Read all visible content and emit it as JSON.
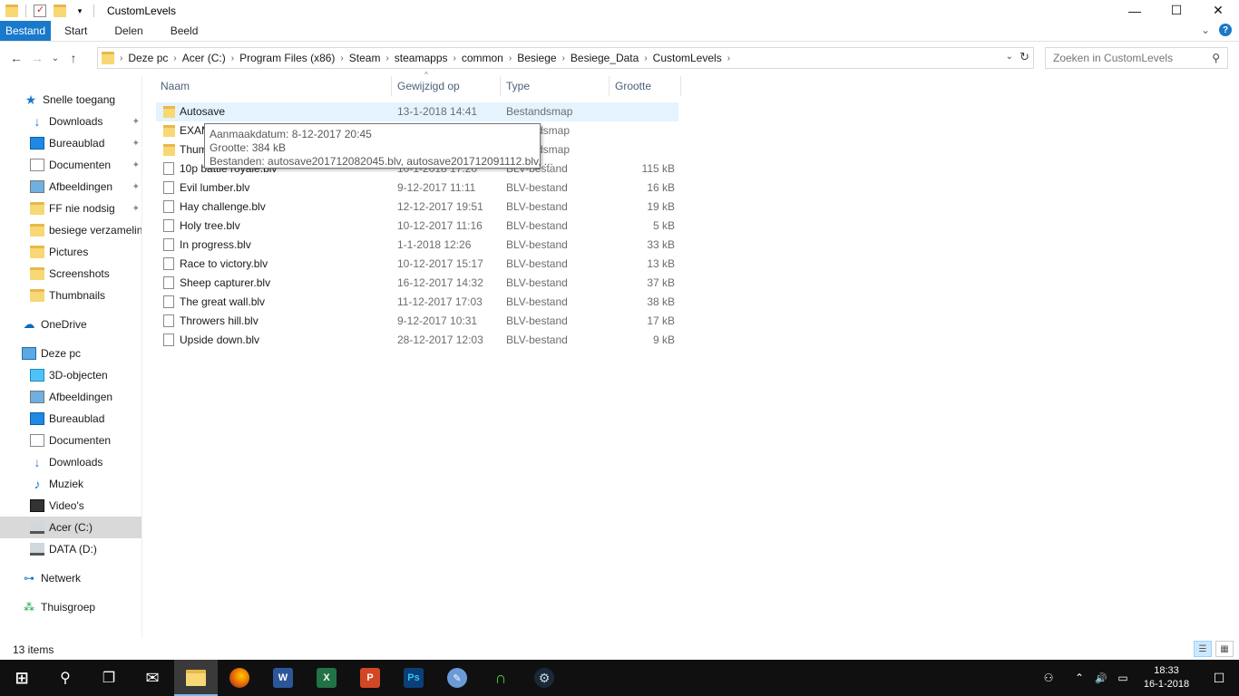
{
  "window": {
    "title": "CustomLevels",
    "minimize": "—",
    "maximize": "☐",
    "close": "✕"
  },
  "ribbon": {
    "tabs": [
      "Bestand",
      "Start",
      "Delen",
      "Beeld"
    ],
    "expand": "⌄",
    "help": "?"
  },
  "nav": {
    "back": "←",
    "forward": "→",
    "recent": "⌄",
    "up": "↑",
    "breadcrumbs": [
      "Deze pc",
      "Acer (C:)",
      "Program Files (x86)",
      "Steam",
      "steamapps",
      "common",
      "Besiege",
      "Besiege_Data",
      "CustomLevels"
    ],
    "dropdown": "⌄",
    "refresh": "↻"
  },
  "search": {
    "placeholder": "Zoeken in CustomLevels",
    "icon": "search-icon"
  },
  "sidebar": {
    "items": [
      {
        "label": "Snelle toegang",
        "icon": "star-icon",
        "pinned": false
      },
      {
        "label": "Downloads",
        "icon": "download-icon",
        "pinned": true
      },
      {
        "label": "Bureaublad",
        "icon": "desktop-icon",
        "pinned": true
      },
      {
        "label": "Documenten",
        "icon": "document-icon",
        "pinned": true
      },
      {
        "label": "Afbeeldingen",
        "icon": "pictures-icon",
        "pinned": true
      },
      {
        "label": "FF nie nodsig",
        "icon": "folder-icon",
        "pinned": true
      },
      {
        "label": "besiege verzameling",
        "icon": "folder-icon",
        "pinned": false
      },
      {
        "label": "Pictures",
        "icon": "folder-icon",
        "pinned": false
      },
      {
        "label": "Screenshots",
        "icon": "folder-icon",
        "pinned": false
      },
      {
        "label": "Thumbnails",
        "icon": "folder-icon",
        "pinned": false
      },
      {
        "label": "OneDrive",
        "icon": "cloud-icon",
        "pinned": false
      },
      {
        "label": "Deze pc",
        "icon": "computer-icon",
        "pinned": false
      },
      {
        "label": "3D-objecten",
        "icon": "3d-objects-icon",
        "pinned": false
      },
      {
        "label": "Afbeeldingen",
        "icon": "pictures-icon",
        "pinned": false
      },
      {
        "label": "Bureaublad",
        "icon": "desktop-icon",
        "pinned": false
      },
      {
        "label": "Documenten",
        "icon": "document-icon",
        "pinned": false
      },
      {
        "label": "Downloads",
        "icon": "download-icon",
        "pinned": false
      },
      {
        "label": "Muziek",
        "icon": "music-icon",
        "pinned": false
      },
      {
        "label": "Video's",
        "icon": "video-icon",
        "pinned": false
      },
      {
        "label": "Acer (C:)",
        "icon": "drive-icon",
        "pinned": false,
        "selected": true
      },
      {
        "label": "DATA (D:)",
        "icon": "drive-icon",
        "pinned": false
      },
      {
        "label": "Netwerk",
        "icon": "network-icon",
        "pinned": false
      },
      {
        "label": "Thuisgroep",
        "icon": "homegroup-icon",
        "pinned": false
      }
    ],
    "pin_glyph": "📌"
  },
  "filelist": {
    "columns": [
      "Naam",
      "Gewijzigd op",
      "Type",
      "Grootte"
    ],
    "sort_glyph": "^",
    "rows": [
      {
        "name": "Autosave",
        "date": "13-1-2018 14:41",
        "type": "Bestandsmap",
        "size": "",
        "kind": "folder"
      },
      {
        "name": "EXAM",
        "date": "",
        "type": "dsmap",
        "size": "",
        "kind": "folder"
      },
      {
        "name": "Thum",
        "date": "",
        "type": "dsmap",
        "size": "",
        "kind": "folder"
      },
      {
        "name": "10p battle royale.blv",
        "date": "10-1-2018 17:20",
        "type": "BLV-bestand",
        "size": "115 kB",
        "kind": "file"
      },
      {
        "name": "Evil lumber.blv",
        "date": "9-12-2017 11:11",
        "type": "BLV-bestand",
        "size": "16 kB",
        "kind": "file"
      },
      {
        "name": "Hay challenge.blv",
        "date": "12-12-2017 19:51",
        "type": "BLV-bestand",
        "size": "19 kB",
        "kind": "file"
      },
      {
        "name": "Holy tree.blv",
        "date": "10-12-2017 11:16",
        "type": "BLV-bestand",
        "size": "5 kB",
        "kind": "file"
      },
      {
        "name": "In progress.blv",
        "date": "1-1-2018 12:26",
        "type": "BLV-bestand",
        "size": "33 kB",
        "kind": "file"
      },
      {
        "name": "Race to victory.blv",
        "date": "10-12-2017 15:17",
        "type": "BLV-bestand",
        "size": "13 kB",
        "kind": "file"
      },
      {
        "name": "Sheep capturer.blv",
        "date": "16-12-2017 14:32",
        "type": "BLV-bestand",
        "size": "37 kB",
        "kind": "file"
      },
      {
        "name": "The great wall.blv",
        "date": "11-12-2017 17:03",
        "type": "BLV-bestand",
        "size": "38 kB",
        "kind": "file"
      },
      {
        "name": "Throwers hill.blv",
        "date": "9-12-2017 10:31",
        "type": "BLV-bestand",
        "size": "17 kB",
        "kind": "file"
      },
      {
        "name": "Upside down.blv",
        "date": "28-12-2017 12:03",
        "type": "BLV-bestand",
        "size": "9 kB",
        "kind": "file"
      }
    ]
  },
  "tooltip": {
    "line1": "Aanmaakdatum: 8-12-2017 20:45",
    "line2": "Grootte: 384 kB",
    "line3": "Bestanden: autosave201712082045.blv, autosave201712091112.blv, ..."
  },
  "status": {
    "count": "13 items"
  },
  "taskbar": {
    "apps": [
      {
        "name": "start-icon",
        "glyph": "⊞",
        "color": "#101010"
      },
      {
        "name": "search-icon",
        "glyph": "⚲",
        "color": "#101010"
      },
      {
        "name": "task-view-icon",
        "glyph": "❐",
        "color": "#101010"
      },
      {
        "name": "mail-icon",
        "glyph": "✉",
        "color": "#101010"
      },
      {
        "name": "file-explorer-icon",
        "glyph": "",
        "color": "#f8d775",
        "active": true
      },
      {
        "name": "firefox-icon",
        "glyph": "",
        "color": "#e66000"
      },
      {
        "name": "word-icon",
        "glyph": "W",
        "color": "#2b579a"
      },
      {
        "name": "excel-icon",
        "glyph": "X",
        "color": "#217346"
      },
      {
        "name": "powerpoint-icon",
        "glyph": "P",
        "color": "#d24726"
      },
      {
        "name": "photoshop-icon",
        "glyph": "Ps",
        "color": "#0b3f7a"
      },
      {
        "name": "paint-icon",
        "glyph": "✎",
        "color": "#6a9bd8"
      },
      {
        "name": "razer-icon",
        "glyph": "∩",
        "color": "#101010"
      },
      {
        "name": "steam-icon",
        "glyph": "⚙",
        "color": "#1b2838"
      }
    ],
    "tray": {
      "people": "⚇",
      "chevron": "⌃",
      "volume": "🔊",
      "network": "▭",
      "time": "18:33",
      "date": "16-1-2018",
      "notifications": "☐"
    }
  }
}
